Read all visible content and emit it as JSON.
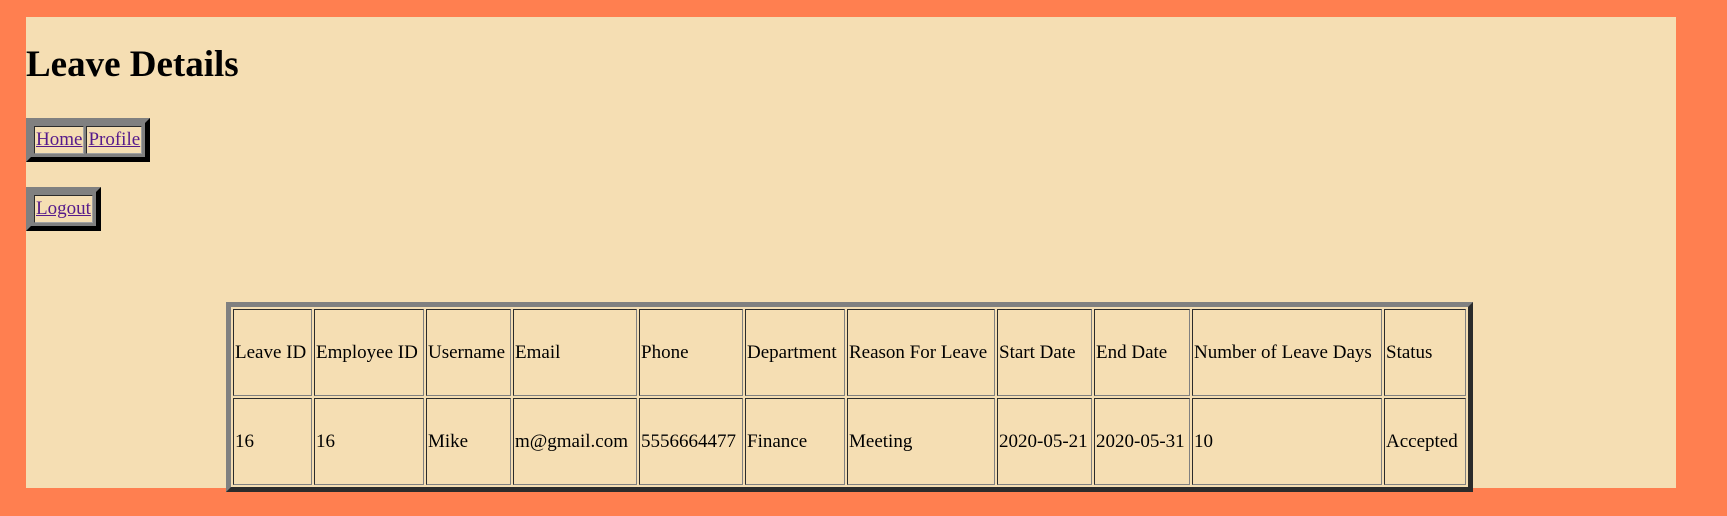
{
  "page": {
    "title": "Leave Details"
  },
  "nav": {
    "home": "Home",
    "profile": "Profile",
    "logout": "Logout"
  },
  "table": {
    "headers": [
      "Leave ID",
      "Employee ID",
      "Username",
      "Email",
      "Phone",
      "Department",
      "Reason For Leave",
      "Start Date",
      "End Date",
      "Number of Leave Days",
      "Status"
    ],
    "rows": [
      [
        "16",
        "16",
        "Mike",
        "m@gmail.com",
        "5556664477",
        "Finance",
        "Meeting",
        "2020-05-21",
        "2020-05-31",
        "10",
        "Accepted"
      ]
    ]
  },
  "colors": {
    "background": "#FF7F50",
    "content": "#F5DEB3",
    "link": "#551A8B"
  }
}
